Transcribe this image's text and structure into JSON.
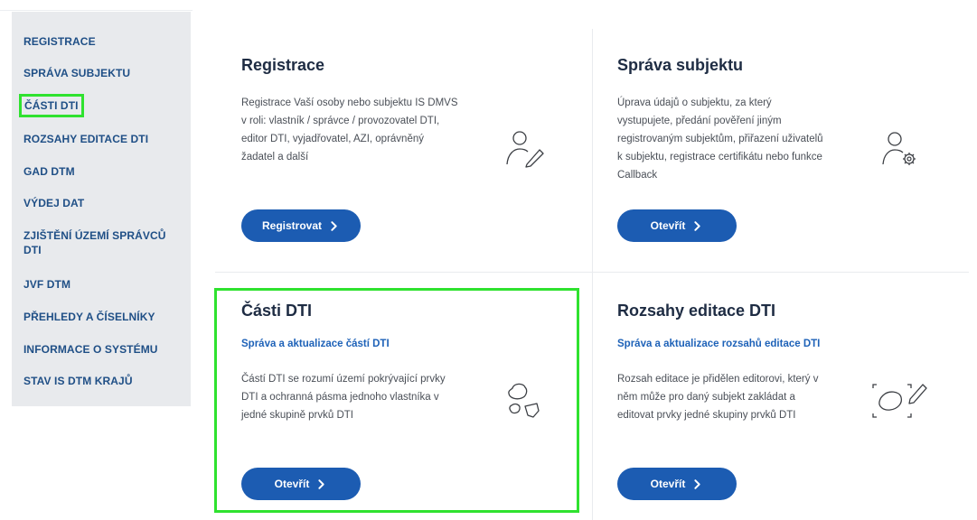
{
  "sidebar": {
    "items": [
      {
        "label": "REGISTRACE"
      },
      {
        "label": "SPRÁVA SUBJEKTU"
      },
      {
        "label": "ČÁSTI DTI"
      },
      {
        "label": "ROZSAHY EDITACE DTI"
      },
      {
        "label": "GAD DTM"
      },
      {
        "label": "VÝDEJ DAT"
      },
      {
        "label": "ZJIŠTĚNÍ ÚZEMÍ SPRÁVCŮ DTI"
      },
      {
        "label": "JVF DTM"
      },
      {
        "label": "PŘEHLEDY A ČÍSELNÍKY"
      },
      {
        "label": "INFORMACE O SYSTÉMU"
      },
      {
        "label": "STAV IS DTM KRAJŮ"
      }
    ]
  },
  "cards": [
    {
      "title": "Registrace",
      "subtitle": "",
      "description": "Registrace Vaší osoby nebo subjektu IS DMVS v roli: vlastník / správce / provozovatel DTI, editor DTI, vyjadřovatel, AZI, oprávněný žadatel a další",
      "button": "Registrovat",
      "icon": "user-edit-icon"
    },
    {
      "title": "Správa subjektu",
      "subtitle": "",
      "description": "Úprava údajů o subjektu, za který vystupujete, předání pověření jiným registrovaným subjektům, přiřazení uživatelů k subjektu, registrace certifikátu nebo funkce Callback",
      "button": "Otevřít",
      "icon": "user-settings-icon"
    },
    {
      "title": "Části DTI",
      "subtitle": "Správa a aktualizace částí DTI",
      "description": "Částí DTI se rozumí území pokrývající prvky DTI a ochranná pásma jednoho vlastníka v jedné skupině prvků DTI",
      "button": "Otevřít",
      "icon": "areas-icon"
    },
    {
      "title": "Rozsahy editace DTI",
      "subtitle": "Správa a aktualizace rozsahů editace DTI",
      "description": "Rozsah editace je přidělen editorovi, který v něm může pro daný subjekt zakládat a editovat prvky jedné skupiny prvků DTI",
      "button": "Otevřít",
      "icon": "area-edit-icon"
    }
  ],
  "colors": {
    "accent": "#1c5cb2",
    "sidebar_text": "#1f4f86",
    "highlight": "#2fe22f",
    "sidebar_bg": "#e8eaed"
  }
}
